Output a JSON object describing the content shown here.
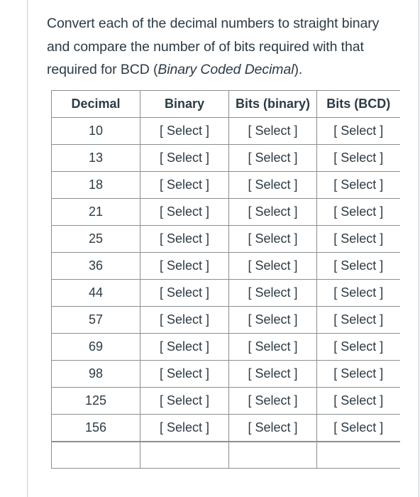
{
  "question": {
    "text_before": "Convert each of the decimal numbers to straight binary and compare the number of of bits required with that required for BCD (",
    "text_italic": "Binary Coded Decimal",
    "text_after": ")."
  },
  "table": {
    "headers": [
      "Decimal",
      "Binary",
      "Bits (binary)",
      "Bits (BCD)"
    ],
    "rows": [
      {
        "decimal": "10",
        "binary": "[ Select ]",
        "bits_binary": "[ Select ]",
        "bits_bcd": "[ Select ]"
      },
      {
        "decimal": "13",
        "binary": "[ Select ]",
        "bits_binary": "[ Select ]",
        "bits_bcd": "[ Select ]"
      },
      {
        "decimal": "18",
        "binary": "[ Select ]",
        "bits_binary": "[ Select ]",
        "bits_bcd": "[ Select ]"
      },
      {
        "decimal": "21",
        "binary": "[ Select ]",
        "bits_binary": "[ Select ]",
        "bits_bcd": "[ Select ]"
      },
      {
        "decimal": "25",
        "binary": "[ Select ]",
        "bits_binary": "[ Select ]",
        "bits_bcd": "[ Select ]"
      },
      {
        "decimal": "36",
        "binary": "[ Select ]",
        "bits_binary": "[ Select ]",
        "bits_bcd": "[ Select ]"
      },
      {
        "decimal": "44",
        "binary": "[ Select ]",
        "bits_binary": "[ Select ]",
        "bits_bcd": "[ Select ]"
      },
      {
        "decimal": "57",
        "binary": "[ Select ]",
        "bits_binary": "[ Select ]",
        "bits_bcd": "[ Select ]"
      },
      {
        "decimal": "69",
        "binary": "[ Select ]",
        "bits_binary": "[ Select ]",
        "bits_bcd": "[ Select ]"
      },
      {
        "decimal": "98",
        "binary": "[ Select ]",
        "bits_binary": "[ Select ]",
        "bits_bcd": "[ Select ]"
      },
      {
        "decimal": "125",
        "binary": "[ Select ]",
        "bits_binary": "[ Select ]",
        "bits_bcd": "[ Select ]"
      },
      {
        "decimal": "156",
        "binary": "[ Select ]",
        "bits_binary": "[ Select ]",
        "bits_bcd": "[ Select ]"
      }
    ]
  }
}
